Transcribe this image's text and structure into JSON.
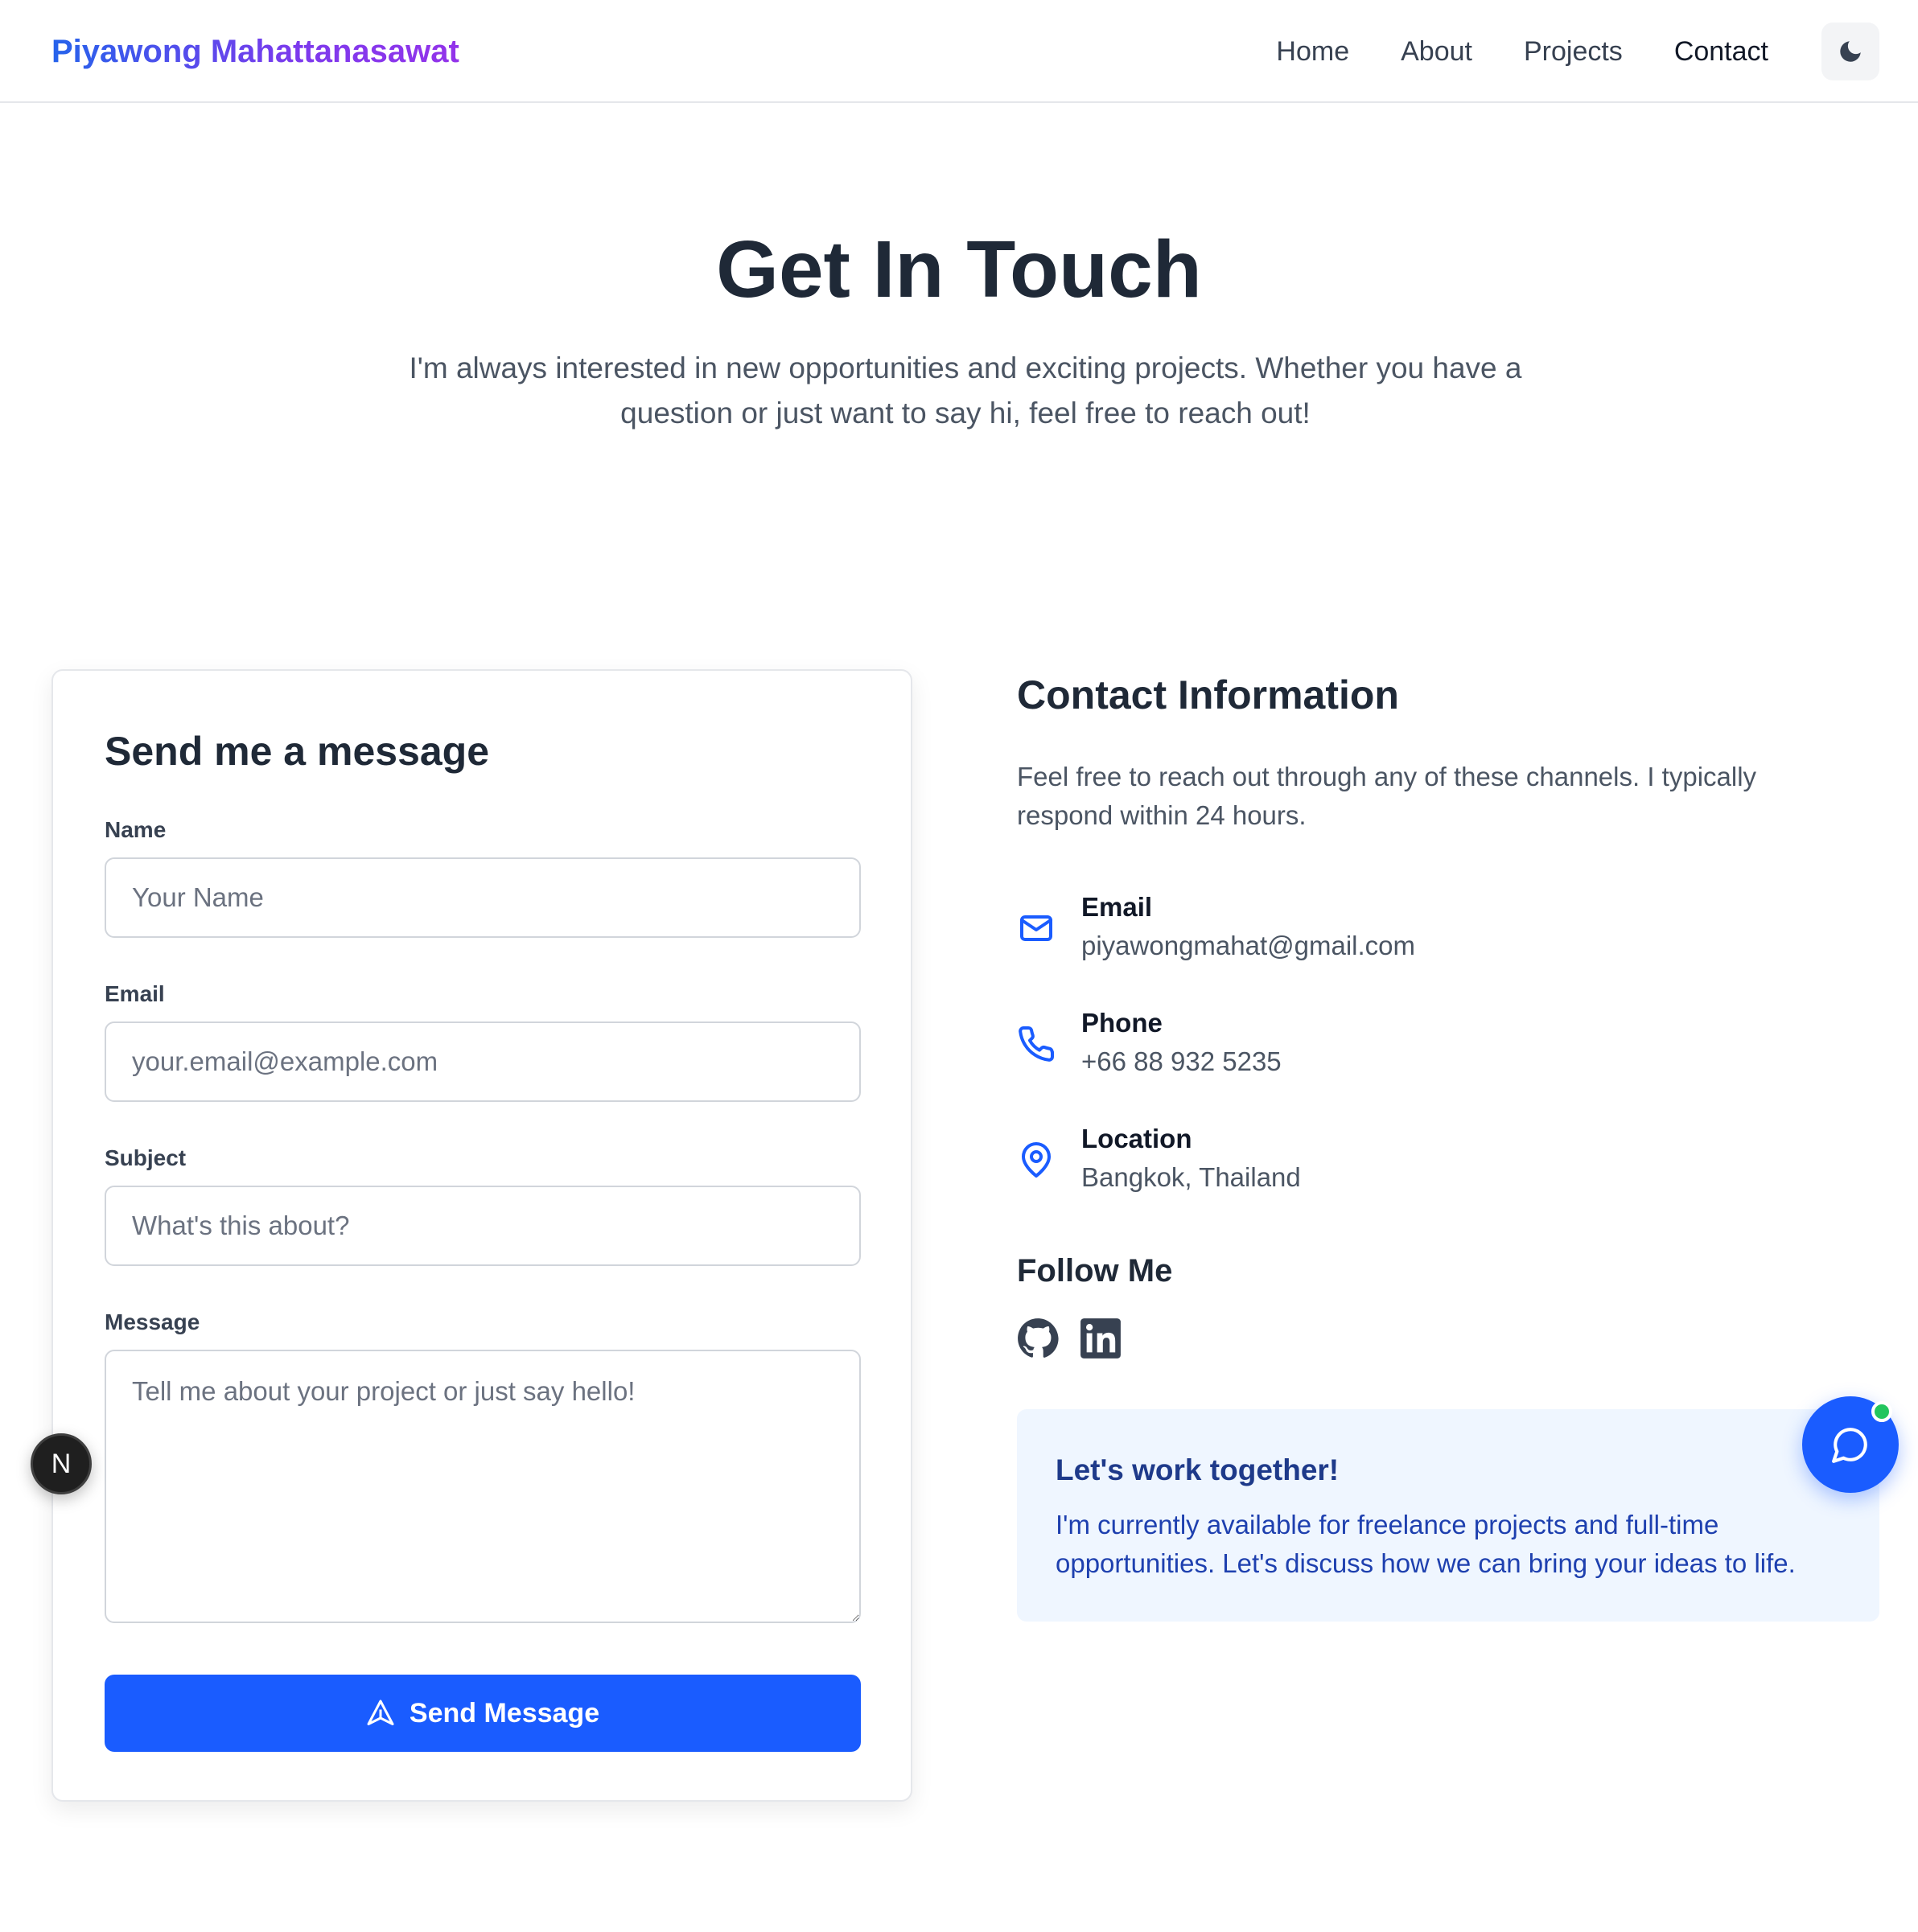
{
  "header": {
    "brand": "Piyawong Mahattanasawat",
    "nav": [
      "Home",
      "About",
      "Projects",
      "Contact"
    ],
    "active_nav": "Contact",
    "theme_toggle_icon": "moon-icon"
  },
  "hero": {
    "title": "Get In Touch",
    "subtitle": "I'm always interested in new opportunities and exciting projects. Whether you have a question or just want to say hi, feel free to reach out!"
  },
  "form": {
    "title": "Send me a message",
    "name": {
      "label": "Name",
      "placeholder": "Your Name",
      "value": ""
    },
    "email": {
      "label": "Email",
      "placeholder": "your.email@example.com",
      "value": ""
    },
    "subject": {
      "label": "Subject",
      "placeholder": "What's this about?",
      "value": ""
    },
    "message": {
      "label": "Message",
      "placeholder": "Tell me about your project or just say hello!",
      "value": ""
    },
    "submit_label": "Send Message",
    "submit_icon": "send-icon"
  },
  "contact": {
    "title": "Contact Information",
    "description": "Feel free to reach out through any of these channels. I typically respond within 24 hours.",
    "items": [
      {
        "icon": "mail-icon",
        "label": "Email",
        "value": "piyawongmahat@gmail.com"
      },
      {
        "icon": "phone-icon",
        "label": "Phone",
        "value": "+66 88 932 5235"
      },
      {
        "icon": "map-pin-icon",
        "label": "Location",
        "value": "Bangkok, Thailand"
      }
    ],
    "follow_title": "Follow Me",
    "socials": [
      "github-icon",
      "linkedin-icon"
    ]
  },
  "callout": {
    "title": "Let's work together!",
    "text": "I'm currently available for freelance projects and full-time opportunities. Let's discuss how we can bring your ideas to life."
  },
  "floating": {
    "next_badge": "N",
    "chat_icon": "chat-bubble-icon"
  },
  "colors": {
    "primary": "#1a5cff",
    "brand_gradient_start": "#2563eb",
    "brand_gradient_end": "#9333ea",
    "online_dot": "#22c55e",
    "callout_bg": "#eff6ff"
  }
}
